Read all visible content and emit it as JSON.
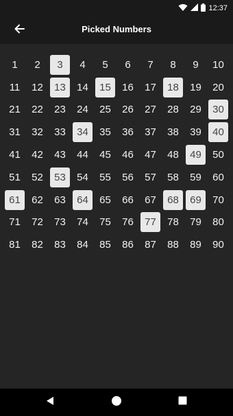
{
  "status_bar": {
    "time": "12:37"
  },
  "app_bar": {
    "title": "Picked Numbers"
  },
  "numbers": [
    "1",
    "2",
    "3",
    "4",
    "5",
    "6",
    "7",
    "8",
    "9",
    "10",
    "11",
    "12",
    "13",
    "14",
    "15",
    "16",
    "17",
    "18",
    "19",
    "20",
    "21",
    "22",
    "23",
    "24",
    "25",
    "26",
    "27",
    "28",
    "29",
    "30",
    "31",
    "32",
    "33",
    "34",
    "35",
    "36",
    "37",
    "38",
    "39",
    "40",
    "41",
    "42",
    "43",
    "44",
    "45",
    "46",
    "47",
    "48",
    "49",
    "50",
    "51",
    "52",
    "53",
    "54",
    "55",
    "56",
    "57",
    "58",
    "59",
    "60",
    "61",
    "62",
    "63",
    "64",
    "65",
    "66",
    "67",
    "68",
    "69",
    "70",
    "71",
    "72",
    "73",
    "74",
    "75",
    "76",
    "77",
    "78",
    "79",
    "80",
    "81",
    "82",
    "83",
    "84",
    "85",
    "86",
    "87",
    "88",
    "89",
    "90"
  ],
  "picked": [
    3,
    13,
    15,
    18,
    30,
    34,
    40,
    49,
    53,
    61,
    64,
    68,
    69,
    77
  ],
  "colors": {
    "background": "#252525",
    "picked_tile": "#e8e8e8",
    "picked_text": "#444444",
    "number_text": "#f2f2f2"
  }
}
